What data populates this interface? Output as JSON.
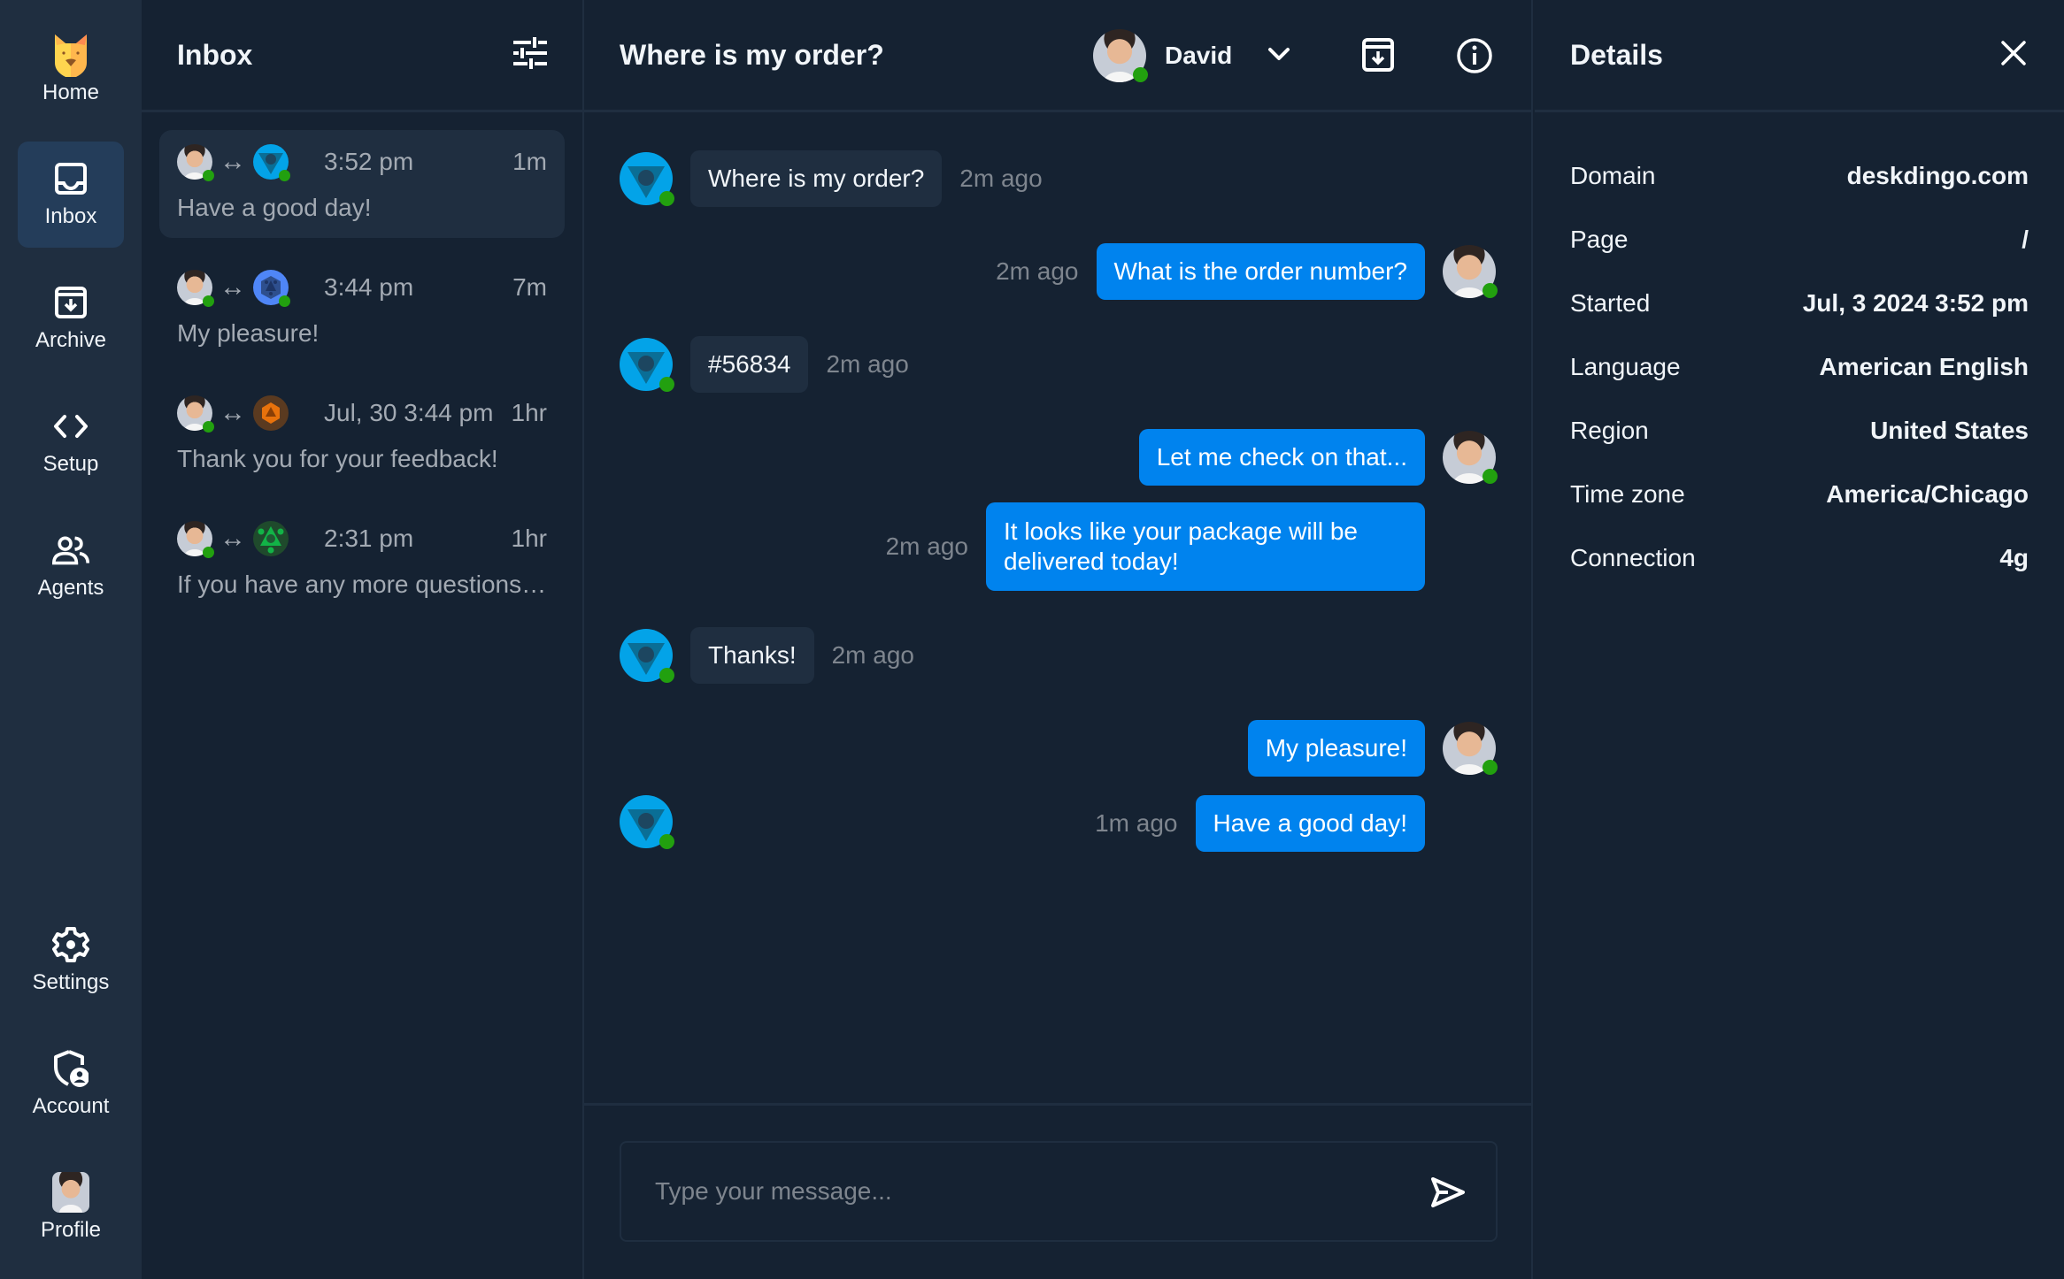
{
  "sidebar": {
    "items": [
      {
        "label": "Home",
        "icon": "dingo-logo-icon"
      },
      {
        "label": "Inbox",
        "icon": "inbox-icon",
        "active": true
      },
      {
        "label": "Archive",
        "icon": "archive-icon"
      },
      {
        "label": "Setup",
        "icon": "code-icon"
      },
      {
        "label": "Agents",
        "icon": "users-icon"
      },
      {
        "label": "Settings",
        "icon": "gear-icon"
      },
      {
        "label": "Account",
        "icon": "shield-user-icon"
      },
      {
        "label": "Profile",
        "icon": "profile-avatar"
      }
    ]
  },
  "inbox": {
    "title": "Inbox",
    "filter_icon": "sliders-icon",
    "conversations": [
      {
        "time": "3:52 pm",
        "age": "1m",
        "preview": "Have a good day!",
        "customer_color": "#03a3e8",
        "active": true
      },
      {
        "time": "3:44 pm",
        "age": "7m",
        "preview": "My pleasure!",
        "customer_color": "#4f86f7"
      },
      {
        "time": "Jul, 30 3:44 pm",
        "age": "1hr",
        "preview": "Thank you for your feedback!",
        "customer_color": "#e8720c"
      },
      {
        "time": "2:31 pm",
        "age": "1hr",
        "preview": "If you have any more questions…",
        "customer_color": "#12b347"
      }
    ]
  },
  "chat": {
    "title": "Where is my order?",
    "assignee": {
      "name": "David",
      "status": "online"
    },
    "messages": [
      {
        "from": "customer",
        "text": "Where is my order?",
        "time": "2m ago"
      },
      {
        "from": "agent",
        "text": "What is the order number?",
        "time": "2m ago"
      },
      {
        "from": "customer",
        "text": "#56834",
        "time": "2m ago"
      },
      {
        "from": "agent",
        "text": "Let me check on that...",
        "time": ""
      },
      {
        "from": "agent",
        "text": "It looks like your package will be delivered today!",
        "time": "2m ago"
      },
      {
        "from": "customer",
        "text": "Thanks!",
        "time": "2m ago"
      },
      {
        "from": "agent",
        "text": "My pleasure!",
        "time": ""
      },
      {
        "from": "agent",
        "text": "Have a good day!",
        "time": "1m ago"
      }
    ],
    "composer": {
      "placeholder": "Type your message..."
    }
  },
  "details": {
    "title": "Details",
    "rows": [
      {
        "label": "Domain",
        "value": "deskdingo.com"
      },
      {
        "label": "Page",
        "value": "/"
      },
      {
        "label": "Started",
        "value": "Jul, 3 2024 3:52 pm"
      },
      {
        "label": "Language",
        "value": "American English"
      },
      {
        "label": "Region",
        "value": "United States"
      },
      {
        "label": "Time zone",
        "value": "America/Chicago"
      },
      {
        "label": "Connection",
        "value": "4g"
      }
    ]
  },
  "colors": {
    "background": "#152232",
    "sidebar": "#1f2e40",
    "active_nav": "#243d5a",
    "agent_bubble": "#0083ee",
    "customer_bubble": "#1f2e40",
    "online": "#22a00f"
  }
}
